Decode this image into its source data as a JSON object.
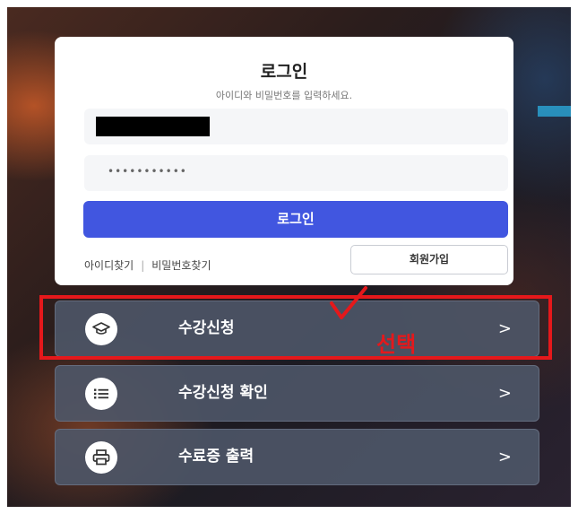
{
  "login": {
    "title": "로그인",
    "subtitle": "아이디와 비밀번호를 입력하세요.",
    "password_mask": "•••••••••••",
    "login_button": "로그인",
    "find_id": "아이디찾기",
    "separator": "|",
    "find_password": "비밀번호찾기",
    "signup_button": "회원가입"
  },
  "menu": [
    {
      "label": "수강신청",
      "icon": "graduation-cap-icon",
      "chevron": ">"
    },
    {
      "label": "수강신청 확인",
      "icon": "list-icon",
      "chevron": ">"
    },
    {
      "label": "수료증 출력",
      "icon": "printer-icon",
      "chevron": ">"
    }
  ],
  "annotation": {
    "text": "선택",
    "color": "#e5181b"
  },
  "colors": {
    "primary": "#4156e0",
    "menu_bg": "#4e5668"
  }
}
